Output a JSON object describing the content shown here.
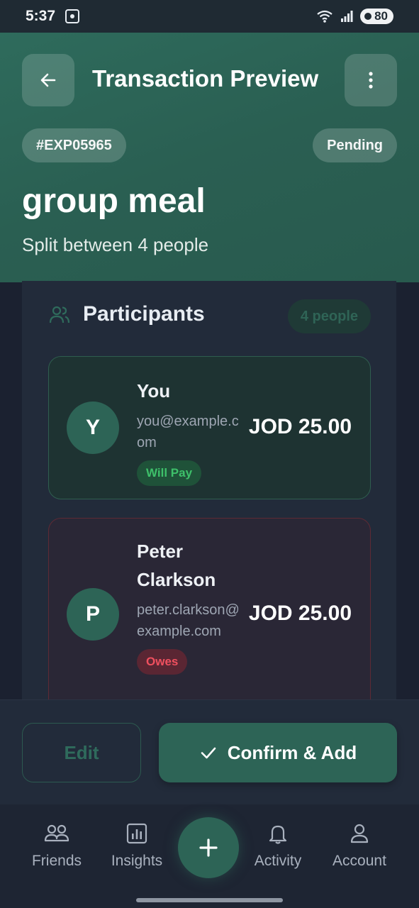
{
  "status_bar": {
    "time": "5:37",
    "battery": "80"
  },
  "header": {
    "title": "Transaction Preview",
    "expense_id": "#EXP05965",
    "status": "Pending",
    "name": "group meal",
    "subtitle": "Split between 4 people"
  },
  "participants": {
    "title": "Participants",
    "count": "4 people",
    "items": [
      {
        "initial": "Y",
        "name": "You",
        "email": "you@example.com",
        "badge": "Will Pay",
        "amount": "JOD 25.00"
      },
      {
        "initial": "P",
        "name": "Peter Clarkson",
        "email": "peter.clarkson@example.com",
        "badge": "Owes",
        "amount": "JOD 25.00"
      }
    ]
  },
  "actions": {
    "edit": "Edit",
    "confirm": "Confirm & Add"
  },
  "nav": {
    "friends": "Friends",
    "insights": "Insights",
    "activity": "Activity",
    "account": "Account"
  },
  "colors": {
    "accent": "#2d6456",
    "header_bg": "#2a5f52",
    "pay_green": "#3ec06a",
    "owes_red": "#f0505f"
  }
}
